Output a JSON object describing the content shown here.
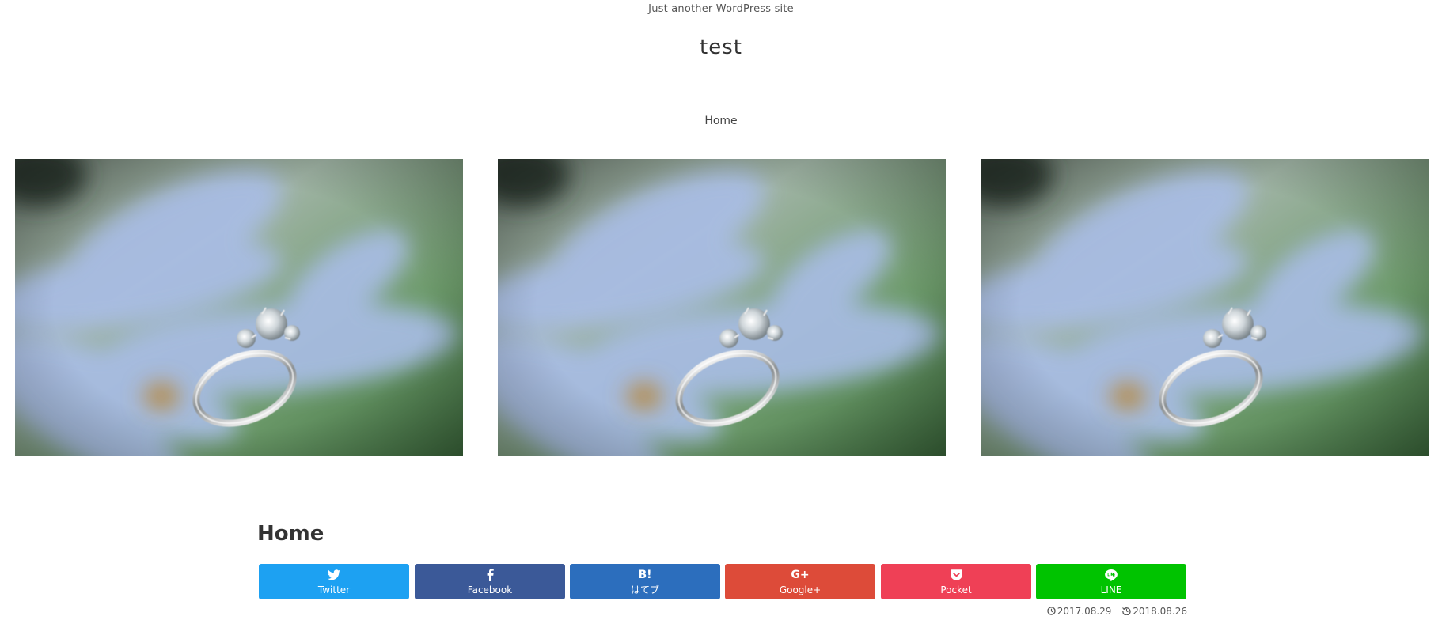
{
  "site": {
    "tagline": "Just another WordPress site",
    "title": "test"
  },
  "nav": {
    "items": [
      {
        "label": "Home"
      }
    ]
  },
  "slider": {
    "slides": [
      {
        "image": "ring-on-blue-flower"
      },
      {
        "image": "ring-on-blue-flower"
      },
      {
        "image": "ring-on-blue-flower"
      }
    ]
  },
  "entry": {
    "title": "Home",
    "published": "2017.08.29",
    "updated": "2018.08.26"
  },
  "share": {
    "buttons": [
      {
        "label": "Twitter",
        "icon": "twitter-icon",
        "color": "#1da1f2"
      },
      {
        "label": "Facebook",
        "icon": "facebook-icon",
        "color": "#3b5998"
      },
      {
        "label": "はてブ",
        "icon": "hatena-bookmark-icon",
        "glyph": "B!",
        "color": "#2c6ebd"
      },
      {
        "label": "Google+",
        "icon": "google-plus-icon",
        "glyph": "G+",
        "color": "#dd4b39"
      },
      {
        "label": "Pocket",
        "icon": "pocket-icon",
        "color": "#ef4056"
      },
      {
        "label": "LINE",
        "icon": "line-icon",
        "color": "#00c300"
      }
    ]
  }
}
